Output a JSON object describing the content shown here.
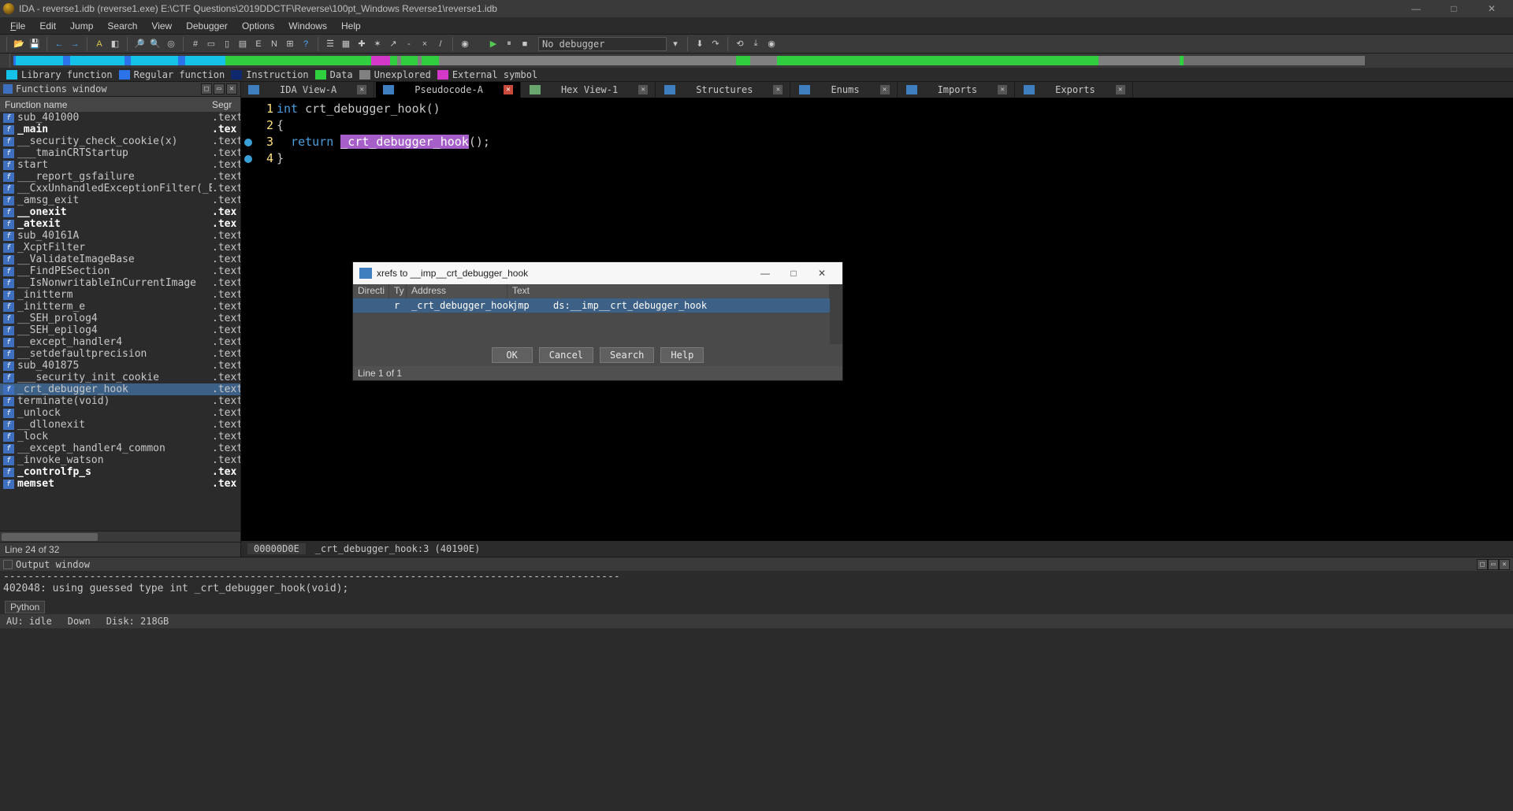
{
  "window": {
    "title": "IDA - reverse1.idb (reverse1.exe) E:\\CTF Questions\\2019DDCTF\\Reverse\\100pt_Windows Reverse1\\reverse1.idb",
    "minimize": "—",
    "maximize": "□",
    "close": "✕"
  },
  "menu": {
    "file": "File",
    "edit": "Edit",
    "jump": "Jump",
    "search": "Search",
    "view": "View",
    "debugger": "Debugger",
    "options": "Options",
    "windows": "Windows",
    "help": "Help"
  },
  "toolbar": {
    "debugger_select": "No debugger"
  },
  "legend": {
    "lib": "Library function",
    "reg": "Regular function",
    "instr": "Instruction",
    "data": "Data",
    "unexp": "Unexplored",
    "ext": "External symbol"
  },
  "colors": {
    "lib": "#15c2e8",
    "reg": "#2c72e8",
    "instr": "#10296e",
    "data": "#2fcf3f",
    "unexp": "#808080",
    "ext": "#d338c9"
  },
  "functions_panel": {
    "title": "Functions window",
    "col_name": "Function name",
    "col_seg": "Segr",
    "status": "Line 24 of 32",
    "items": [
      {
        "name": "sub_401000",
        "seg": ".text",
        "bold": false
      },
      {
        "name": "_main",
        "seg": ".tex",
        "bold": true
      },
      {
        "name": "__security_check_cookie(x)",
        "seg": ".text",
        "bold": false
      },
      {
        "name": "___tmainCRTStartup",
        "seg": ".text",
        "bold": false
      },
      {
        "name": "start",
        "seg": ".text",
        "bold": false
      },
      {
        "name": "___report_gsfailure",
        "seg": ".text",
        "bold": false
      },
      {
        "name": "__CxxUnhandledExceptionFilter(_EXCE…",
        "seg": ".text",
        "bold": false
      },
      {
        "name": "_amsg_exit",
        "seg": ".text",
        "bold": false
      },
      {
        "name": "__onexit",
        "seg": ".tex",
        "bold": true
      },
      {
        "name": "_atexit",
        "seg": ".tex",
        "bold": true
      },
      {
        "name": "sub_40161A",
        "seg": ".text",
        "bold": false
      },
      {
        "name": "_XcptFilter",
        "seg": ".text",
        "bold": false
      },
      {
        "name": "__ValidateImageBase",
        "seg": ".text",
        "bold": false
      },
      {
        "name": "__FindPESection",
        "seg": ".text",
        "bold": false
      },
      {
        "name": "__IsNonwritableInCurrentImage",
        "seg": ".text",
        "bold": false
      },
      {
        "name": "_initterm",
        "seg": ".text",
        "bold": false
      },
      {
        "name": "_initterm_e",
        "seg": ".text",
        "bold": false
      },
      {
        "name": "__SEH_prolog4",
        "seg": ".text",
        "bold": false
      },
      {
        "name": "__SEH_epilog4",
        "seg": ".text",
        "bold": false
      },
      {
        "name": "__except_handler4",
        "seg": ".text",
        "bold": false
      },
      {
        "name": "__setdefaultprecision",
        "seg": ".text",
        "bold": false
      },
      {
        "name": "sub_401875",
        "seg": ".text",
        "bold": false
      },
      {
        "name": "___security_init_cookie",
        "seg": ".text",
        "bold": false
      },
      {
        "name": "_crt_debugger_hook",
        "seg": ".text",
        "bold": false,
        "selected": true
      },
      {
        "name": "terminate(void)",
        "seg": ".text",
        "bold": false
      },
      {
        "name": "_unlock",
        "seg": ".text",
        "bold": false
      },
      {
        "name": "__dllonexit",
        "seg": ".text",
        "bold": false
      },
      {
        "name": "_lock",
        "seg": ".text",
        "bold": false
      },
      {
        "name": "__except_handler4_common",
        "seg": ".text",
        "bold": false
      },
      {
        "name": "_invoke_watson",
        "seg": ".text",
        "bold": false
      },
      {
        "name": "_controlfp_s",
        "seg": ".tex",
        "bold": true
      },
      {
        "name": "memset",
        "seg": ".tex",
        "bold": true
      }
    ]
  },
  "tabs": [
    {
      "label": "IDA View-A",
      "icon_bg": "#3f7fbf",
      "active": false,
      "close": "grey"
    },
    {
      "label": "Pseudocode-A",
      "icon_bg": "#3f7fbf",
      "active": true,
      "close": "red"
    },
    {
      "label": "Hex View-1",
      "icon_bg": "#69a76f",
      "active": false,
      "close": "grey"
    },
    {
      "label": "Structures",
      "icon_bg": "#3f7fbf",
      "active": false,
      "close": "grey"
    },
    {
      "label": "Enums",
      "icon_bg": "#3f7fbf",
      "active": false,
      "close": "grey"
    },
    {
      "label": "Imports",
      "icon_bg": "#3f7fbf",
      "active": false,
      "close": "grey"
    },
    {
      "label": "Exports",
      "icon_bg": "#3f7fbf",
      "active": false,
      "close": "grey"
    }
  ],
  "code": {
    "l1_kw": "int",
    "l1_fn": " crt_debugger_hook",
    "l1_rest": "()",
    "l2": "{",
    "l3_kw": "  return ",
    "l3_hl": "_crt_debugger_hook",
    "l3_rest": "();",
    "l4": "}"
  },
  "code_status": {
    "offset": "00000D0E",
    "loc": "_crt_debugger_hook:3 (40190E)"
  },
  "output": {
    "title": "Output window",
    "dash_line": "----------------------------------------------------------------------------------------------------",
    "line2": "402048: using guessed type int _crt_debugger_hook(void);"
  },
  "python_tab": "Python",
  "statusbar": {
    "au": "AU: idle",
    "down": "Down",
    "disk": "Disk: 218GB"
  },
  "dialog": {
    "title": "xrefs to __imp__crt_debugger_hook",
    "min": "—",
    "max": "□",
    "close": "✕",
    "col_dir": "Directi",
    "col_ty": "Ty",
    "col_addr": "Address",
    "col_txt": "Text",
    "row": {
      "ty": "r",
      "addr": "_crt_debugger_hook",
      "op": "jmp",
      "target": "ds:__imp__crt_debugger_hook"
    },
    "btn_ok": "OK",
    "btn_cancel": "Cancel",
    "btn_search": "Search",
    "btn_help": "Help",
    "status": "Line 1 of 1"
  }
}
